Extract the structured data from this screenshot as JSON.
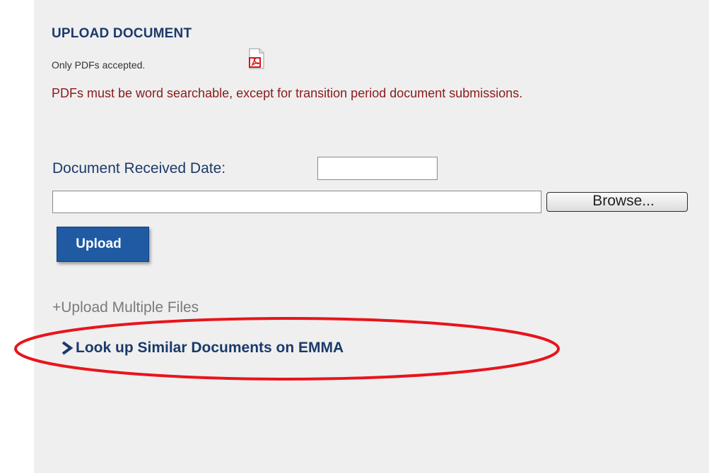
{
  "upload": {
    "title": "UPLOAD DOCUMENT",
    "only_pdfs": "Only PDFs accepted.",
    "warning": "PDFs must be word searchable, except for transition period document submissions.",
    "date_label": "Document Received Date:",
    "date_value": "",
    "file_value": "",
    "browse_label": "Browse...",
    "upload_label": "Upload",
    "multi_link": "+Upload Multiple Files",
    "lookup_link": "Look up Similar Documents on EMMA"
  },
  "colors": {
    "panel_bg": "#efefef",
    "title": "#1b3a6b",
    "warning": "#8b1a1a",
    "upload_btn": "#1f5aa3",
    "multi_link": "#7a7a7a",
    "annotation": "#e8141c"
  },
  "icons": {
    "pdf": "pdf-file-icon",
    "chevron": "chevron-right-icon"
  }
}
